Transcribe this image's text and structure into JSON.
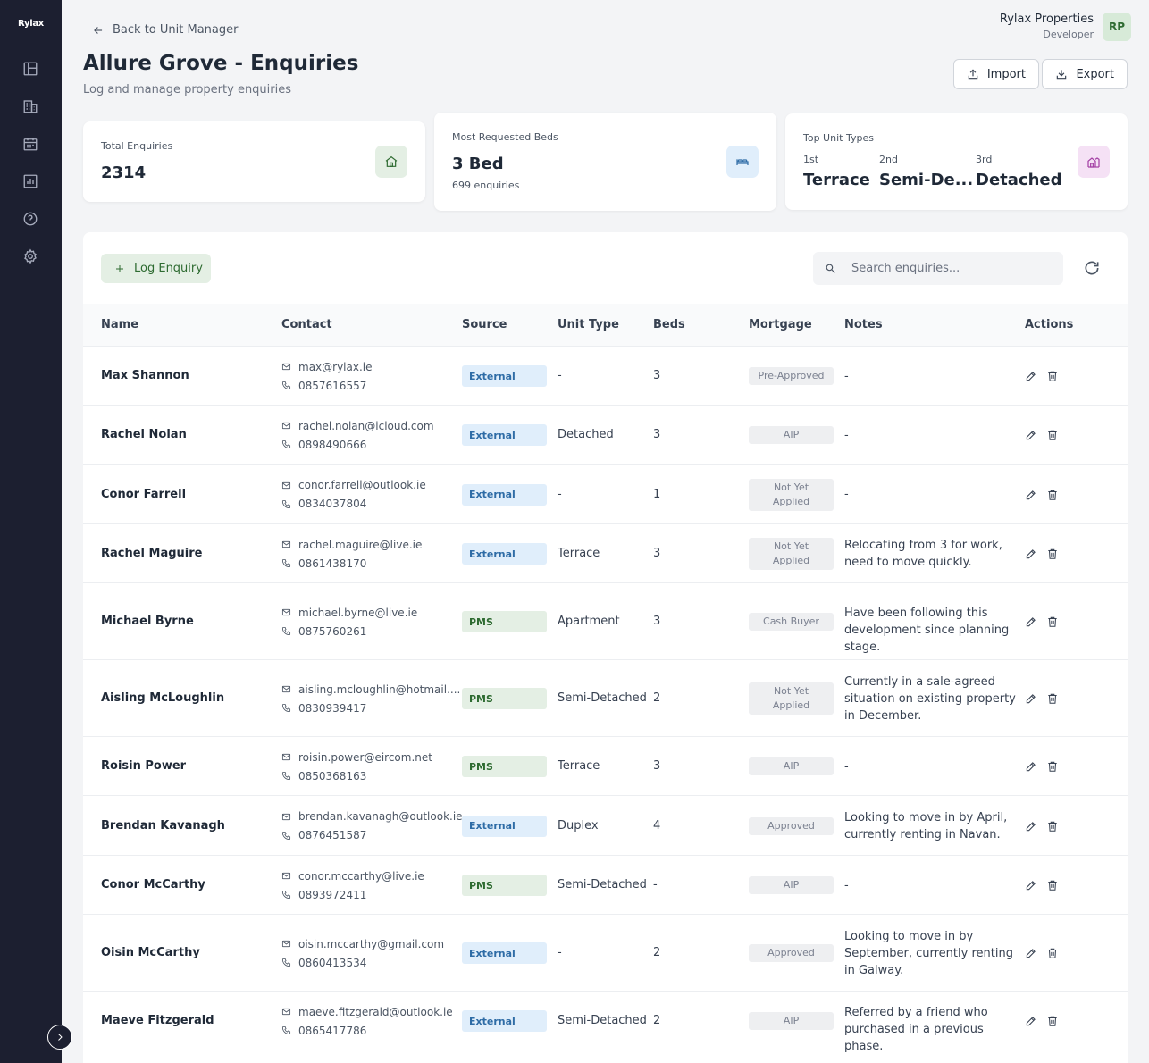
{
  "app": {
    "logo": "Rylax"
  },
  "sidebar": {
    "icons": [
      "dashboard-icon",
      "buildings-icon",
      "calendar-icon",
      "reports-icon",
      "help-icon",
      "settings-icon"
    ]
  },
  "header": {
    "back_label": "Back to Unit Manager",
    "title": "Allure Grove - Enquiries",
    "subtitle": "Log and manage property enquiries",
    "user_name": "Rylax Properties",
    "user_role": "Developer",
    "avatar_initials": "RP",
    "import_label": "Import",
    "export_label": "Export"
  },
  "stats": {
    "total": {
      "label": "Total Enquiries",
      "value": "2314"
    },
    "beds": {
      "label": "Most Requested Beds",
      "value": "3 Bed",
      "sub": "699 enquiries"
    },
    "unit_types": {
      "label": "Top Unit Types",
      "ranks": [
        {
          "rank": "1st",
          "value": "Terrace"
        },
        {
          "rank": "2nd",
          "value": "Semi-De..."
        },
        {
          "rank": "3rd",
          "value": "Detached"
        }
      ]
    }
  },
  "toolbar": {
    "log_label": "Log Enquiry",
    "search_placeholder": "Search enquiries..."
  },
  "table": {
    "columns": [
      "Name",
      "Contact",
      "Source",
      "Unit Type",
      "Beds",
      "Mortgage",
      "Notes",
      "Actions"
    ],
    "rows": [
      {
        "name": "Max Shannon",
        "email": "max@rylax.ie",
        "phone": "0857616557",
        "source": "External",
        "unit_type": "-",
        "beds": "3",
        "mortgage": "Pre-Approved",
        "notes": "-"
      },
      {
        "name": "Rachel Nolan",
        "email": "rachel.nolan@icloud.com",
        "phone": "0898490666",
        "source": "External",
        "unit_type": "Detached",
        "beds": "3",
        "mortgage": "AIP",
        "notes": "-"
      },
      {
        "name": "Conor Farrell",
        "email": "conor.farrell@outlook.ie",
        "phone": "0834037804",
        "source": "External",
        "unit_type": "-",
        "beds": "1",
        "mortgage": "Not Yet Applied",
        "notes": "-"
      },
      {
        "name": "Rachel Maguire",
        "email": "rachel.maguire@live.ie",
        "phone": "0861438170",
        "source": "External",
        "unit_type": "Terrace",
        "beds": "3",
        "mortgage": "Not Yet Applied",
        "notes": "Relocating from 3 for work, need to move quickly."
      },
      {
        "name": "Michael Byrne",
        "email": "michael.byrne@live.ie",
        "phone": "0875760261",
        "source": "PMS",
        "unit_type": "Apartment",
        "beds": "3",
        "mortgage": "Cash Buyer",
        "notes": "Have been following this development since planning stage."
      },
      {
        "name": "Aisling McLoughlin",
        "email": "aisling.mcloughlin@hotmail....",
        "phone": "0830939417",
        "source": "PMS",
        "unit_type": "Semi-Detached",
        "beds": "2",
        "mortgage": "Not Yet Applied",
        "notes": "Currently in a sale-agreed situation on existing property in December."
      },
      {
        "name": "Roisin Power",
        "email": "roisin.power@eircom.net",
        "phone": "0850368163",
        "source": "PMS",
        "unit_type": "Terrace",
        "beds": "3",
        "mortgage": "AIP",
        "notes": "-"
      },
      {
        "name": "Brendan Kavanagh",
        "email": "brendan.kavanagh@outlook.ie",
        "phone": "0876451587",
        "source": "External",
        "unit_type": "Duplex",
        "beds": "4",
        "mortgage": "Approved",
        "notes": "Looking to move in by April, currently renting in Navan."
      },
      {
        "name": "Conor McCarthy",
        "email": "conor.mccarthy@live.ie",
        "phone": "0893972411",
        "source": "PMS",
        "unit_type": "Semi-Detached",
        "beds": "-",
        "mortgage": "AIP",
        "notes": "-"
      },
      {
        "name": "Oisin McCarthy",
        "email": "oisin.mccarthy@gmail.com",
        "phone": "0860413534",
        "source": "External",
        "unit_type": "-",
        "beds": "2",
        "mortgage": "Approved",
        "notes": "Looking to move in by September, currently renting in Galway."
      },
      {
        "name": "Maeve Fitzgerald",
        "email": "maeve.fitzgerald@outlook.ie",
        "phone": "0865417786",
        "source": "External",
        "unit_type": "Semi-Detached",
        "beds": "2",
        "mortgage": "AIP",
        "notes": "Referred by a friend who purchased in a previous phase."
      }
    ]
  },
  "colors": {
    "sidebar_bg": "#1c1f30",
    "accent_green": "#2e6b31",
    "external_badge": "#e0eefb",
    "pms_badge": "#e4efe4"
  }
}
